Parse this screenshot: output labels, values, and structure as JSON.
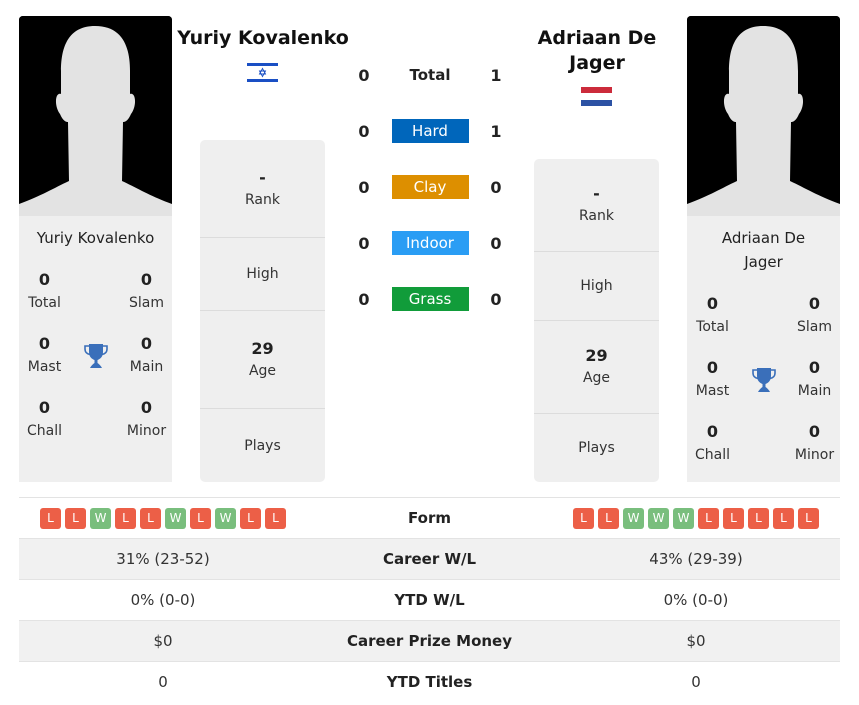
{
  "player1": {
    "name": "Yuriy Kovalenko",
    "card_name": "Yuriy Kovalenko",
    "flag": "Israel",
    "titles": [
      {
        "value": "0",
        "label": "Total"
      },
      {
        "value": "0",
        "label": "Slam"
      },
      {
        "value": "0",
        "label": "Mast"
      },
      {
        "value": "0",
        "label": "Main"
      },
      {
        "value": "0",
        "label": "Chall"
      },
      {
        "value": "0",
        "label": "Minor"
      }
    ],
    "info": {
      "rank_value": "-",
      "rank_label": "Rank",
      "high_label": "High",
      "age_value": "29",
      "age_label": "Age",
      "plays_label": "Plays"
    },
    "form": [
      "L",
      "L",
      "W",
      "L",
      "L",
      "W",
      "L",
      "W",
      "L",
      "L"
    ],
    "career_wl": "31% (23-52)",
    "ytd_wl": "0% (0-0)",
    "prize_money": "$0",
    "ytd_titles": "0"
  },
  "player2": {
    "name": "Adriaan De Jager",
    "card_name": "Adriaan De Jager",
    "flag": "Netherlands",
    "titles": [
      {
        "value": "0",
        "label": "Total"
      },
      {
        "value": "0",
        "label": "Slam"
      },
      {
        "value": "0",
        "label": "Mast"
      },
      {
        "value": "0",
        "label": "Main"
      },
      {
        "value": "0",
        "label": "Chall"
      },
      {
        "value": "0",
        "label": "Minor"
      }
    ],
    "info": {
      "rank_value": "-",
      "rank_label": "Rank",
      "high_label": "High",
      "age_value": "29",
      "age_label": "Age",
      "plays_label": "Plays"
    },
    "form": [
      "L",
      "L",
      "W",
      "W",
      "W",
      "L",
      "L",
      "L",
      "L",
      "L"
    ],
    "career_wl": "43% (29-39)",
    "ytd_wl": "0% (0-0)",
    "prize_money": "$0",
    "ytd_titles": "0"
  },
  "h2h": [
    {
      "surface": "Total",
      "p1": "0",
      "p2": "1",
      "color": ""
    },
    {
      "surface": "Hard",
      "p1": "0",
      "p2": "1",
      "color": "#0066bb"
    },
    {
      "surface": "Clay",
      "p1": "0",
      "p2": "0",
      "color": "#dd8f00"
    },
    {
      "surface": "Indoor",
      "p1": "0",
      "p2": "0",
      "color": "#2a9df4"
    },
    {
      "surface": "Grass",
      "p1": "0",
      "p2": "0",
      "color": "#119c3a"
    }
  ],
  "comparison": {
    "form_label": "Form",
    "career_wl_label": "Career W/L",
    "ytd_wl_label": "YTD W/L",
    "prize_label": "Career Prize Money",
    "ytd_titles_label": "YTD Titles"
  },
  "colors": {
    "loss": "#ec5f47",
    "win": "#79be7d",
    "trophy": "#3a6fba"
  }
}
